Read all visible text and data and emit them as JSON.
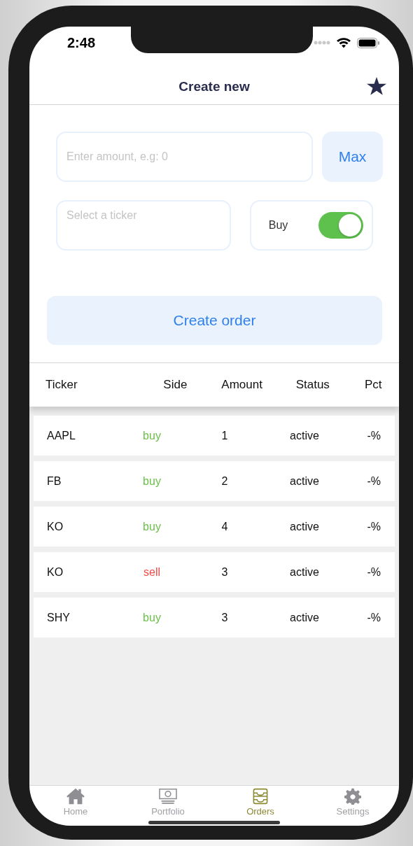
{
  "status_bar": {
    "time": "2:48"
  },
  "header": {
    "title": "Create new"
  },
  "form": {
    "amount": {
      "placeholder": "Enter amount, e.g: 0"
    },
    "max_button": "Max",
    "ticker": {
      "placeholder": "Select a ticker"
    },
    "side_toggle": {
      "label": "Buy",
      "on": true
    },
    "submit": "Create order"
  },
  "table": {
    "columns": [
      "Ticker",
      "Side",
      "Amount",
      "Status",
      "Pct"
    ],
    "rows": [
      {
        "ticker": "AAPL",
        "side": "buy",
        "color": "#6cc04a",
        "amount": "1",
        "status": "active",
        "pct": "-%"
      },
      {
        "ticker": "FB",
        "side": "buy",
        "color": "#6cc04a",
        "amount": "2",
        "status": "active",
        "pct": "-%"
      },
      {
        "ticker": "KO",
        "side": "buy",
        "color": "#6cc04a",
        "amount": "4",
        "status": "active",
        "pct": "-%"
      },
      {
        "ticker": "KO",
        "side": "sell",
        "color": "#ec4c47",
        "amount": "3",
        "status": "active",
        "pct": "-%"
      },
      {
        "ticker": "SHY",
        "side": "buy",
        "color": "#6cc04a",
        "amount": "3",
        "status": "active",
        "pct": "-%"
      }
    ]
  },
  "tab_bar": [
    {
      "label": "Home",
      "kind": "home",
      "selected": false
    },
    {
      "label": "Portfolio",
      "kind": "money",
      "selected": false
    },
    {
      "label": "Orders",
      "kind": "inbox",
      "selected": true
    },
    {
      "label": "Settings",
      "kind": "gear",
      "selected": false
    }
  ]
}
